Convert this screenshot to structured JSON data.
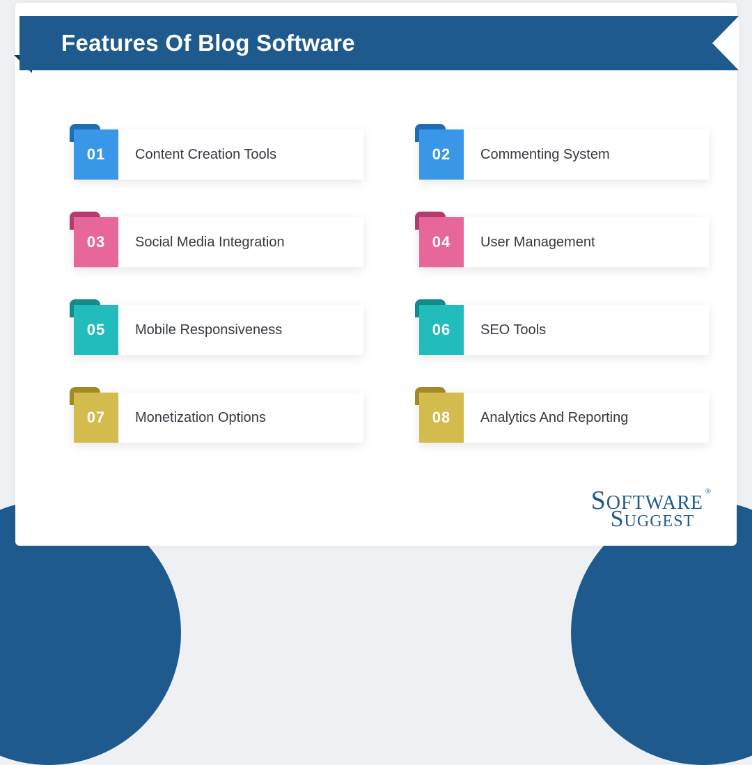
{
  "banner": {
    "title": "Features Of Blog Software"
  },
  "features": [
    {
      "num": "01",
      "label": "Content Creation Tools",
      "color": "blue"
    },
    {
      "num": "02",
      "label": "Commenting System",
      "color": "blue"
    },
    {
      "num": "03",
      "label": "Social Media Integration",
      "color": "pink"
    },
    {
      "num": "04",
      "label": "User Management",
      "color": "pink"
    },
    {
      "num": "05",
      "label": "Mobile Responsiveness",
      "color": "teal"
    },
    {
      "num": "06",
      "label": "SEO Tools",
      "color": "teal"
    },
    {
      "num": "07",
      "label": "Monetization Options",
      "color": "gold"
    },
    {
      "num": "08",
      "label": "Analytics And Reporting",
      "color": "gold"
    }
  ],
  "logo": {
    "line1_caps": "S",
    "line1_rest": "OFTWARE",
    "reg": "®",
    "line2_caps": "S",
    "line2_rest": "UGGEST"
  }
}
